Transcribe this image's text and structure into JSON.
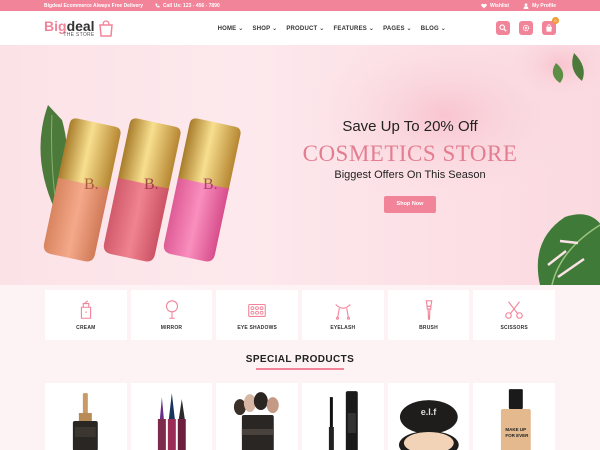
{
  "topbar": {
    "promo": "Bigdeal Ecommerce Always Free Delivery",
    "phone": "Call Us: 123 - 456 - 7890",
    "wishlist": "Wishlist",
    "profile": "My Profile"
  },
  "header": {
    "logo_main_a": "Big",
    "logo_main_b": "deal",
    "logo_sub": "THE STORE",
    "nav": [
      "HOME",
      "SHOP",
      "PRODUCT",
      "FEATURES",
      "PAGES",
      "BLOG"
    ],
    "cart_count": "0",
    "icons": [
      "search-icon",
      "gear-icon",
      "cart-icon"
    ]
  },
  "hero": {
    "subtitle": "Save Up To 20% Off",
    "title": "COSMETICS STORE",
    "description": "Biggest Offers On This Season",
    "button": "Shop Now",
    "lipstick_letter": "B."
  },
  "categories": [
    "CREAM",
    "MIRROR",
    "EYE SHADOWS",
    "EYELASH",
    "BRUSH",
    "SCISSORS"
  ],
  "special": {
    "title": "SPECIAL PRODUCTS"
  },
  "products": {
    "elf_label": "e.l.f",
    "makeup_label_1": "MAKE UP",
    "makeup_label_2": "FOR EVER"
  },
  "colors": {
    "accent": "#f2849a",
    "hero_title": "#e37d90"
  }
}
